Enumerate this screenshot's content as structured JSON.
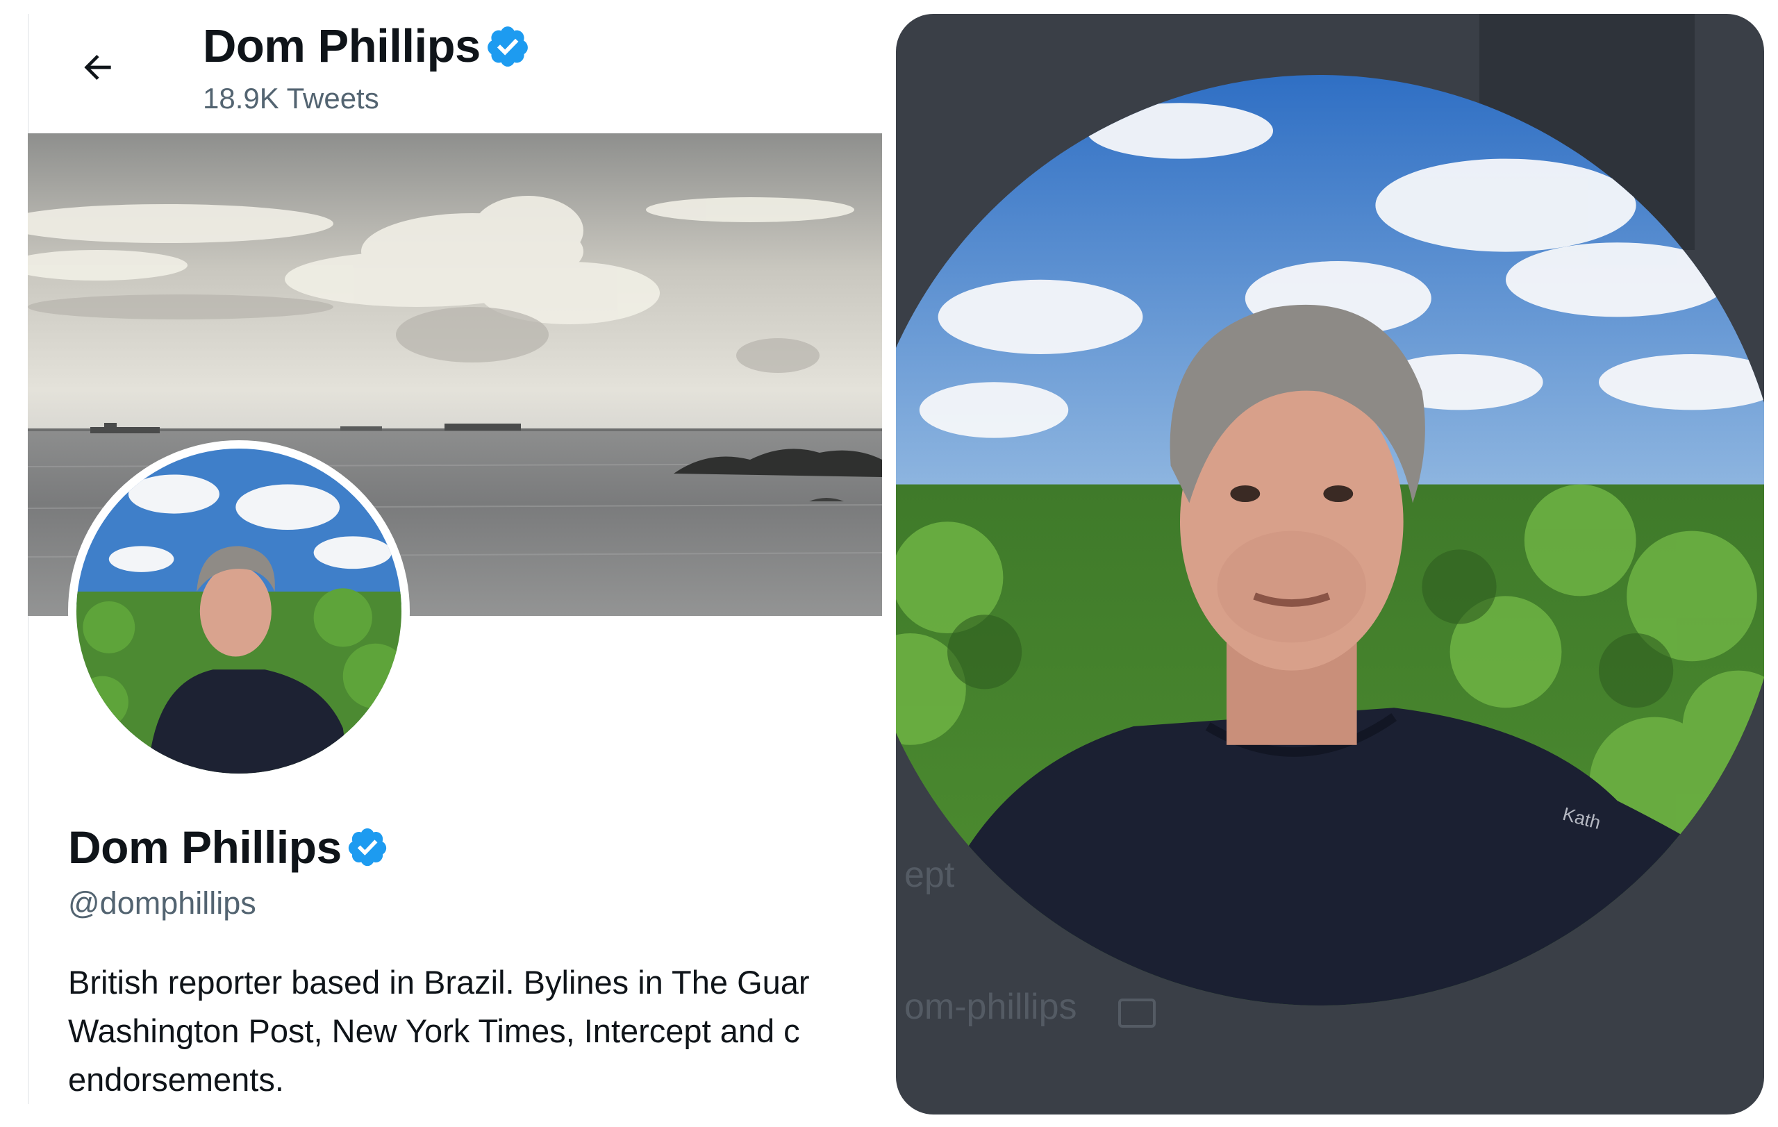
{
  "left_panel": {
    "header": {
      "back_icon": "arrow-left-icon",
      "name": "Dom Phillips",
      "tweet_count": "18.9K Tweets"
    },
    "banner": {
      "description_icon": "ocean-banner-image"
    },
    "profile": {
      "name": "Dom Phillips",
      "handle": "@domphillips",
      "bio_lines": [
        "British reporter based in Brazil. Bylines in The Guar",
        "Washington Post, New York Times, Intercept and c",
        "endorsements."
      ]
    },
    "colors": {
      "verified_blue": "#1d9bf0",
      "secondary_text": "#536471",
      "primary_text": "#0f1419"
    }
  },
  "right_panel": {
    "ghost_text_1": "ept",
    "ghost_text_2": "om-phillips",
    "background": "#3a3f47"
  }
}
